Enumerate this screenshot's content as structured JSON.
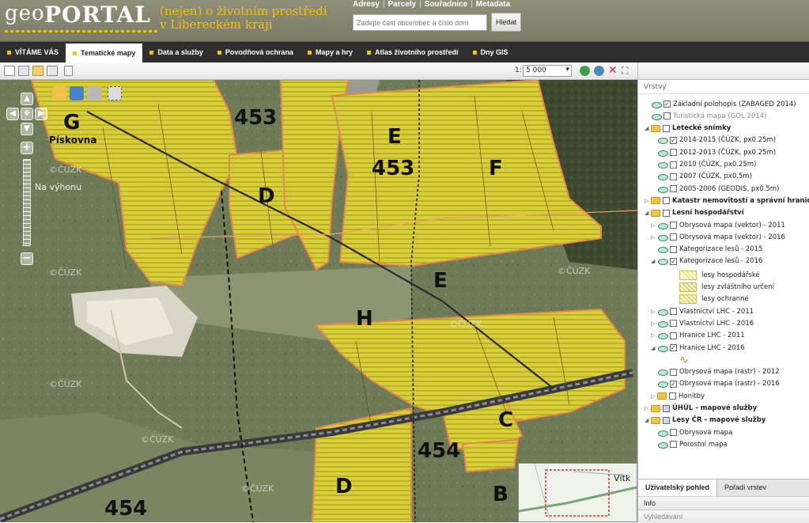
{
  "header": {
    "logo_geo": "geo",
    "logo_portal": "PORTAL",
    "tagline_1": "(nejen) o životním prostředí",
    "tagline_2": "v Libereckém kraji",
    "links": [
      "Adresy",
      "Parcely",
      "Souřadnice",
      "Metadata"
    ],
    "link_separator": "|",
    "search_placeholder": "Zadejte část obce/obec a číslo dom",
    "search_button": "Hledat"
  },
  "nav": {
    "items": [
      {
        "label": "VÍTÁME VÁS",
        "active": false
      },
      {
        "label": "Tematické mapy",
        "active": true
      },
      {
        "label": "Data a služby",
        "active": false
      },
      {
        "label": "Povodňová ochrana",
        "active": false
      },
      {
        "label": "Mapy a hry",
        "active": false
      },
      {
        "label": "Atlas životního prostředí",
        "active": false
      },
      {
        "label": "Dny GIS",
        "active": false
      }
    ]
  },
  "map_toolbar": {
    "scale_prefix": "1:",
    "scale_value": "5 000"
  },
  "map": {
    "watermark": "©ČÚZK",
    "region_labels": [
      "G",
      "D",
      "E",
      "F",
      "E",
      "H",
      "C",
      "D",
      "B"
    ],
    "number_labels_big": [
      "453",
      "453",
      "454",
      "454"
    ],
    "place_labels": [
      "Pískovna",
      "Na výhonu"
    ],
    "overview_label": "Vítk"
  },
  "panel": {
    "title": "Vrstvy",
    "layers": [
      {
        "label": "Základní polohopis (ZABAGED 2014)",
        "type": "layer",
        "checked": true,
        "level": 0,
        "style": "normal"
      },
      {
        "label": "Turistická mapa (GOL 2014)",
        "type": "layer",
        "checked": false,
        "level": 0,
        "style": "gray"
      },
      {
        "label": "Letecké snímky",
        "type": "folder",
        "checked": false,
        "level": 0,
        "style": "bold",
        "expanded": true
      },
      {
        "label": "2014-2015 (ČÚZK, px0.25m)",
        "type": "layer",
        "checked": true,
        "level": 1,
        "style": "normal"
      },
      {
        "label": "2012-2013 (ČÚZK, px0.25m)",
        "type": "layer",
        "checked": false,
        "level": 1,
        "style": "normal"
      },
      {
        "label": "2010 (ČÚZK, px0.25m)",
        "type": "layer",
        "checked": false,
        "level": 1,
        "style": "normal"
      },
      {
        "label": "2007 (ČÚZK, px0.5m)",
        "type": "layer",
        "checked": false,
        "level": 1,
        "style": "normal"
      },
      {
        "label": "2005-2006 (GEODIS, px0.5m)",
        "type": "layer",
        "checked": false,
        "level": 1,
        "style": "normal"
      },
      {
        "label": "Katastr nemovitostí a správní hranice",
        "type": "folder",
        "level": 0,
        "style": "bold",
        "expanded": false
      },
      {
        "label": "Lesní hospodářství",
        "type": "folder",
        "level": 0,
        "style": "bold",
        "expanded": true
      },
      {
        "label": "Obrysová mapa (vektor) - 2011",
        "type": "layer",
        "checked": false,
        "level": 1,
        "style": "normal",
        "expander": true
      },
      {
        "label": "Obrysová mapa (vektor) - 2016",
        "type": "layer",
        "checked": false,
        "level": 1,
        "style": "normal",
        "expander": true
      },
      {
        "label": "Kategorizace lesů - 2015",
        "type": "layer",
        "checked": false,
        "level": 1,
        "style": "normal"
      },
      {
        "label": "Kategorizace lesů - 2016",
        "type": "layer",
        "checked": true,
        "level": 1,
        "style": "normal",
        "expander": true
      },
      {
        "label": "lesy hospodářské",
        "type": "legend",
        "level": 2,
        "swatch": "#f3ec8a"
      },
      {
        "label": "lesy zvláštního určení",
        "type": "legend",
        "level": 2,
        "swatch": "#d9d36b"
      },
      {
        "label": "lesy ochranné",
        "type": "legend",
        "level": 2,
        "swatch": "#e8d46a"
      },
      {
        "label": "Vlastnictví LHC - 2011",
        "type": "layer",
        "checked": false,
        "level": 1,
        "style": "normal",
        "expander": true
      },
      {
        "label": "Vlastnictví LHC - 2016",
        "type": "layer",
        "checked": false,
        "level": 1,
        "style": "normal",
        "expander": true
      },
      {
        "label": "Hranice LHC - 2011",
        "type": "layer",
        "checked": false,
        "level": 1,
        "style": "normal",
        "expander": true
      },
      {
        "label": "Hranice LHC - 2016",
        "type": "layer",
        "checked": true,
        "level": 1,
        "style": "normal",
        "expander": true
      },
      {
        "label": "",
        "type": "line-legend",
        "level": 2
      },
      {
        "label": "Obrysová mapa (rastr) - 2012",
        "type": "layer",
        "checked": false,
        "level": 1,
        "style": "normal"
      },
      {
        "label": "Obrysová mapa (rastr) - 2016",
        "type": "layer",
        "checked": true,
        "level": 1,
        "style": "normal"
      },
      {
        "label": "Honitby",
        "type": "folder",
        "level": 1,
        "style": "normal",
        "expanded": false
      },
      {
        "label": "ÚHÚL - mapové služby",
        "type": "folder",
        "level": 0,
        "style": "bold",
        "expanded": false,
        "mixed": true
      },
      {
        "label": "Lesy ČR - mapové služby",
        "type": "folder",
        "level": 0,
        "style": "bold",
        "expanded": true,
        "mixed": true
      },
      {
        "label": "Obrysová mapa",
        "type": "layer",
        "checked": false,
        "level": 1,
        "style": "normal"
      },
      {
        "label": "Porostní mapa",
        "type": "layer",
        "checked": false,
        "level": 1,
        "style": "normal"
      }
    ],
    "tabs": [
      "Uživatelský pohled",
      "Pořadí vrstev"
    ],
    "bar_info": "Info",
    "bar_search": "Vyhledávání"
  },
  "colors": {
    "forest_fill": "#d8cf37",
    "parcel_border": "#e5894a",
    "accent": "#f3c300"
  }
}
